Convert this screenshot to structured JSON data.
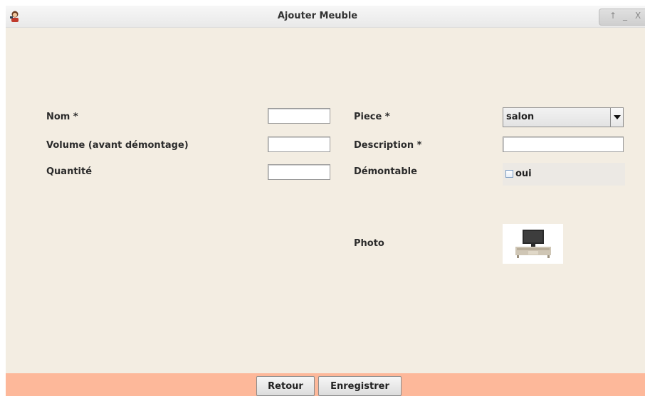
{
  "window": {
    "title": "Ajouter Meuble",
    "controls": [
      "↑",
      "_",
      "X"
    ]
  },
  "form": {
    "nom": {
      "label": "Nom *",
      "value": ""
    },
    "volume": {
      "label": "Volume (avant démontage)",
      "value": ""
    },
    "quantite": {
      "label": "Quantité",
      "value": ""
    },
    "piece": {
      "label": "Piece *",
      "selected": "salon"
    },
    "description": {
      "label": "Description *",
      "value": ""
    },
    "demontable": {
      "label": "Démontable",
      "checkbox_label": "oui",
      "checked": false
    },
    "photo": {
      "label": "Photo"
    }
  },
  "footer": {
    "retour": "Retour",
    "enregistrer": "Enregistrer"
  },
  "colors": {
    "background": "#f3ede2",
    "footer": "#fdb89a"
  }
}
